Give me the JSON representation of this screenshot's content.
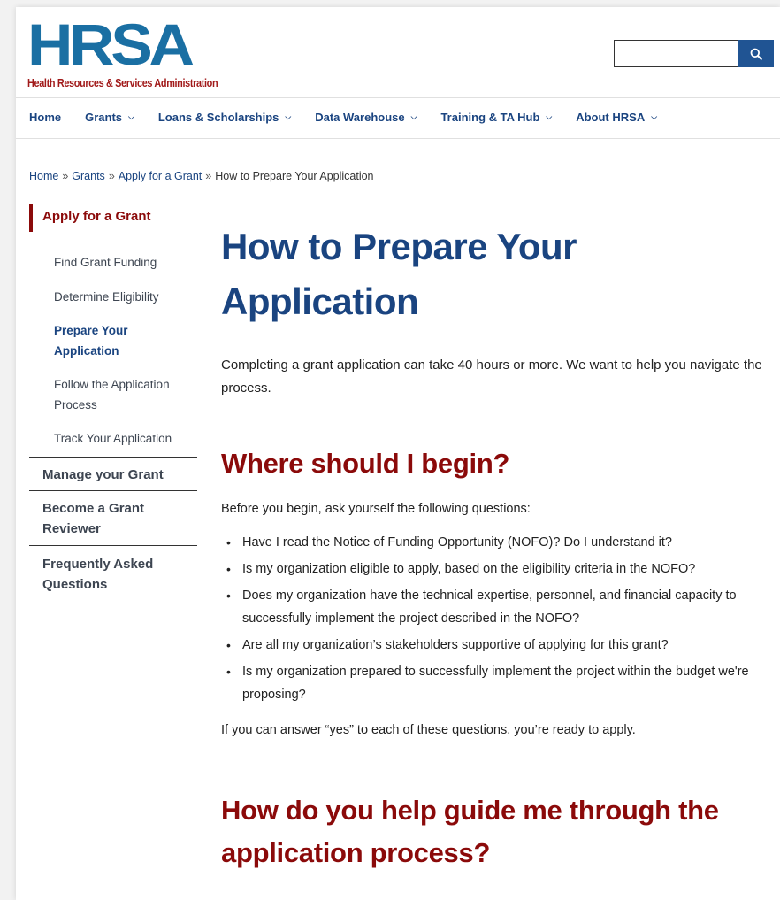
{
  "logo": {
    "mark": "HRSA",
    "subtitle": "Health Resources & Services Administration"
  },
  "search": {
    "placeholder": "",
    "icon": "search-icon"
  },
  "nav": {
    "items": [
      {
        "label": "Home",
        "dropdown": false
      },
      {
        "label": "Grants",
        "dropdown": true
      },
      {
        "label": "Loans & Scholarships",
        "dropdown": true
      },
      {
        "label": "Data Warehouse",
        "dropdown": true
      },
      {
        "label": "Training & TA Hub",
        "dropdown": true
      },
      {
        "label": "About HRSA",
        "dropdown": true
      }
    ],
    "chevron": "⌄"
  },
  "breadcrumb": {
    "links": [
      "Home",
      "Grants",
      "Apply for a Grant"
    ],
    "separator": "»",
    "current": "How to Prepare Your Application"
  },
  "sidebar": {
    "section": "Apply for a Grant",
    "subitems": [
      "Find Grant Funding",
      "Determine Eligibility",
      "Prepare Your Application",
      "Follow the Application Process",
      "Track Your Application"
    ],
    "sections": [
      "Manage your Grant",
      "Become a Grant Reviewer",
      "Frequently Asked Questions"
    ]
  },
  "main": {
    "title": "How to Prepare Your Application",
    "intro": "Completing a grant application can take 40 hours or more. We want to help you navigate the process.",
    "heading_begin": "Where should I begin?",
    "lead": "Before you begin, ask yourself the following questions:",
    "questions": [
      "Have I read the Notice of Funding Opportunity (NOFO)? Do I understand it?",
      "Is my organization eligible to apply, based on the eligibility criteria in the NOFO?",
      "Does my organization have the technical expertise, personnel, and financial capacity to successfully implement the project described in the NOFO?",
      "Are all my organization’s stakeholders supportive of applying for this grant?",
      "Is my organization prepared to successfully implement the project within the budget we're proposing?"
    ],
    "answer": "If you can answer “yes” to each of these questions, you’re ready to apply.",
    "heading_help": "How do you help guide me through the application process?"
  },
  "colors": {
    "brand_blue": "#1a6fa3",
    "nav_blue": "#1a4480",
    "accent_red": "#8b0a0a",
    "search_button": "#205493"
  }
}
